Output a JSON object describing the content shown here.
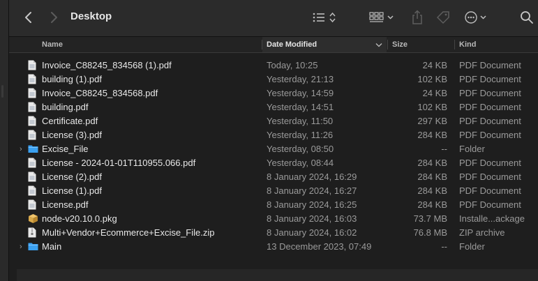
{
  "window": {
    "title": "Desktop"
  },
  "columns": {
    "name": "Name",
    "date": "Date Modified",
    "size": "Size",
    "kind": "Kind"
  },
  "colors": {
    "folder": "#3aa0f0",
    "doc": "#e9e9e9",
    "pkg": "#d9a94a",
    "zip": "#e9e9e9"
  },
  "files": [
    {
      "name": "Invoice_C88245_834568 (1).pdf",
      "date": "Today, 10:25",
      "size": "24 KB",
      "kind": "PDF Document",
      "icon": "pdf-document-icon",
      "expandable": false
    },
    {
      "name": "building (1).pdf",
      "date": "Yesterday, 21:13",
      "size": "102 KB",
      "kind": "PDF Document",
      "icon": "pdf-document-icon",
      "expandable": false
    },
    {
      "name": "Invoice_C88245_834568.pdf",
      "date": "Yesterday, 14:59",
      "size": "24 KB",
      "kind": "PDF Document",
      "icon": "pdf-document-icon",
      "expandable": false
    },
    {
      "name": "building.pdf",
      "date": "Yesterday, 14:51",
      "size": "102 KB",
      "kind": "PDF Document",
      "icon": "pdf-document-icon",
      "expandable": false
    },
    {
      "name": "Certificate.pdf",
      "date": "Yesterday, 11:50",
      "size": "297 KB",
      "kind": "PDF Document",
      "icon": "pdf-document-icon",
      "expandable": false
    },
    {
      "name": "License (3).pdf",
      "date": "Yesterday, 11:26",
      "size": "284 KB",
      "kind": "PDF Document",
      "icon": "pdf-document-icon",
      "expandable": false
    },
    {
      "name": "Excise_File",
      "date": "Yesterday, 08:50",
      "size": "--",
      "kind": "Folder",
      "icon": "folder-icon",
      "expandable": true
    },
    {
      "name": "License - 2024-01-01T110955.066.pdf",
      "date": "Yesterday, 08:44",
      "size": "284 KB",
      "kind": "PDF Document",
      "icon": "pdf-document-icon",
      "expandable": false
    },
    {
      "name": "License (2).pdf",
      "date": "8 January 2024, 16:29",
      "size": "284 KB",
      "kind": "PDF Document",
      "icon": "pdf-document-icon",
      "expandable": false
    },
    {
      "name": "License (1).pdf",
      "date": "8 January 2024, 16:27",
      "size": "284 KB",
      "kind": "PDF Document",
      "icon": "pdf-document-icon",
      "expandable": false
    },
    {
      "name": "License.pdf",
      "date": "8 January 2024, 16:25",
      "size": "284 KB",
      "kind": "PDF Document",
      "icon": "pdf-document-icon",
      "expandable": false
    },
    {
      "name": "node-v20.10.0.pkg",
      "date": "8 January 2024, 16:03",
      "size": "73.7 MB",
      "kind": "Installe...ackage",
      "icon": "package-icon",
      "expandable": false
    },
    {
      "name": "Multi+Vendor+Ecommerce+Excise_File.zip",
      "date": "8 January 2024, 16:02",
      "size": "76.8 MB",
      "kind": "ZIP archive",
      "icon": "zip-archive-icon",
      "expandable": false
    },
    {
      "name": "Main",
      "date": "13 December 2023, 07:49",
      "size": "--",
      "kind": "Folder",
      "icon": "folder-icon",
      "expandable": true
    }
  ]
}
